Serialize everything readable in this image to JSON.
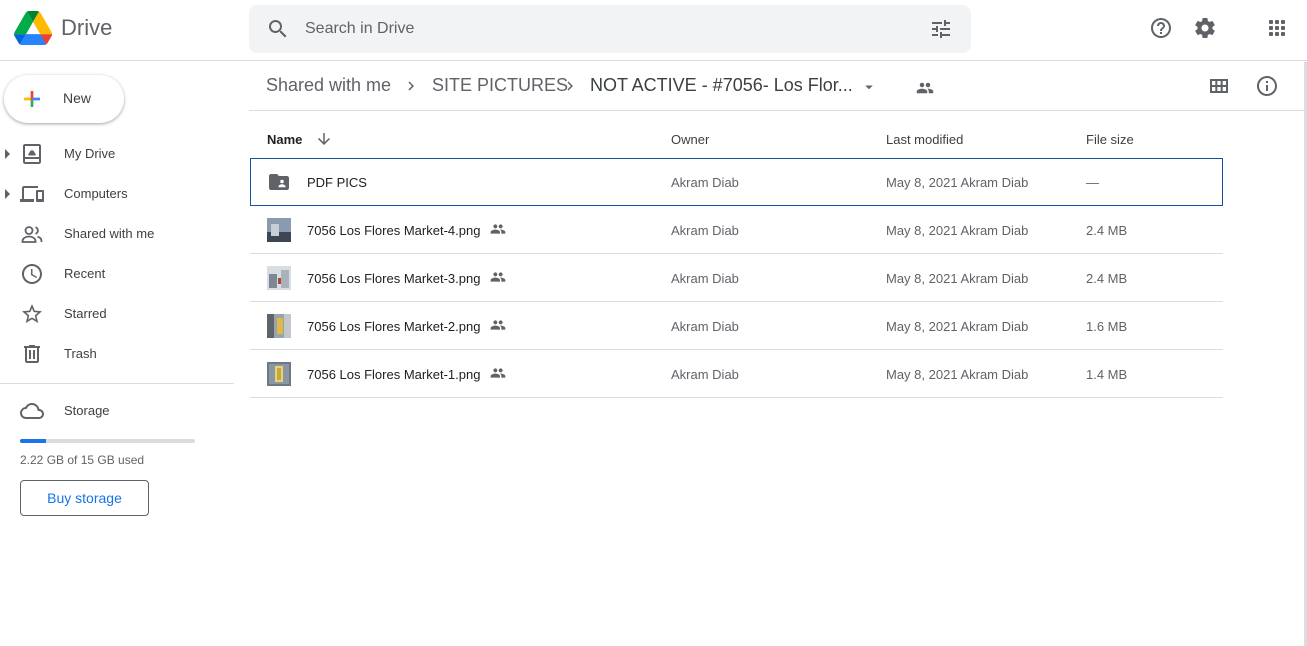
{
  "app": {
    "name": "Drive",
    "search_placeholder": "Search in Drive"
  },
  "sidebar": {
    "new_label": "New",
    "items": [
      {
        "label": "My Drive",
        "icon": "my-drive-icon",
        "expandable": true
      },
      {
        "label": "Computers",
        "icon": "computers-icon",
        "expandable": true
      },
      {
        "label": "Shared with me",
        "icon": "shared-icon",
        "expandable": false
      },
      {
        "label": "Recent",
        "icon": "clock-icon",
        "expandable": false
      },
      {
        "label": "Starred",
        "icon": "star-icon",
        "expandable": false
      },
      {
        "label": "Trash",
        "icon": "trash-icon",
        "expandable": false
      }
    ],
    "storage": {
      "label": "Storage",
      "used_text": "2.22 GB of 15 GB used",
      "used_fraction": 0.148,
      "buy_label": "Buy storage"
    }
  },
  "breadcrumb": {
    "items": [
      "Shared with me",
      "SITE PICTURES",
      "NOT ACTIVE - #7056- Los Flor..."
    ]
  },
  "table": {
    "headers": {
      "name": "Name",
      "owner": "Owner",
      "modified": "Last modified",
      "size": "File size"
    },
    "rows": [
      {
        "name": "PDF PICS",
        "type": "shared-folder",
        "owner": "Akram Diab",
        "modified": "May 8, 2021  Akram Diab",
        "size": "—",
        "shared": false,
        "selected": true
      },
      {
        "name": "7056 Los Flores Market-4.png",
        "type": "image",
        "owner": "Akram Diab",
        "modified": "May 8, 2021  Akram Diab",
        "size": "2.4 MB",
        "shared": true,
        "selected": false
      },
      {
        "name": "7056 Los Flores Market-3.png",
        "type": "image",
        "owner": "Akram Diab",
        "modified": "May 8, 2021  Akram Diab",
        "size": "2.4 MB",
        "shared": true,
        "selected": false
      },
      {
        "name": "7056 Los Flores Market-2.png",
        "type": "image",
        "owner": "Akram Diab",
        "modified": "May 8, 2021  Akram Diab",
        "size": "1.6 MB",
        "shared": true,
        "selected": false
      },
      {
        "name": "7056 Los Flores Market-1.png",
        "type": "image",
        "owner": "Akram Diab",
        "modified": "May 8, 2021  Akram Diab",
        "size": "1.4 MB",
        "shared": true,
        "selected": false
      }
    ]
  },
  "colors": {
    "accent": "#1a73e8",
    "selected_border": "#1a4fa0",
    "divider": "#dadce0"
  }
}
